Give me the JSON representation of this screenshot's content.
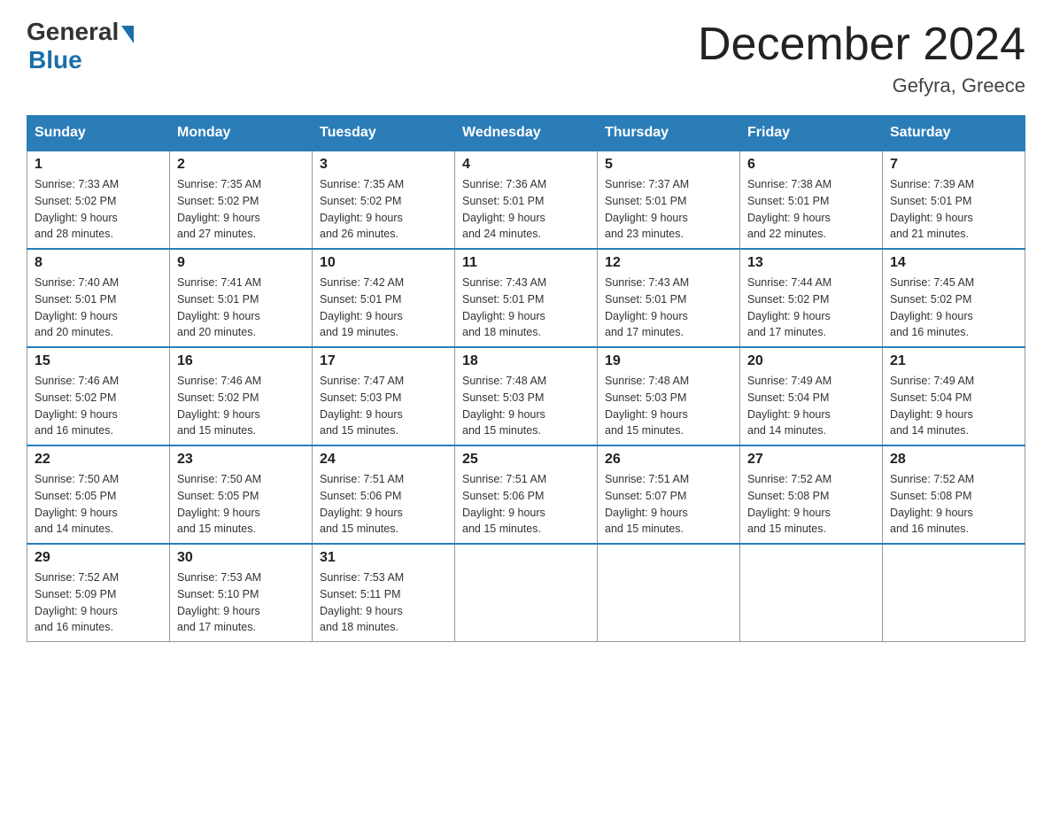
{
  "header": {
    "logo_general": "General",
    "logo_blue": "Blue",
    "month_title": "December 2024",
    "location": "Gefyra, Greece"
  },
  "days_of_week": [
    "Sunday",
    "Monday",
    "Tuesday",
    "Wednesday",
    "Thursday",
    "Friday",
    "Saturday"
  ],
  "weeks": [
    [
      {
        "day": "1",
        "sunrise": "7:33 AM",
        "sunset": "5:02 PM",
        "daylight": "9 hours and 28 minutes."
      },
      {
        "day": "2",
        "sunrise": "7:35 AM",
        "sunset": "5:02 PM",
        "daylight": "9 hours and 27 minutes."
      },
      {
        "day": "3",
        "sunrise": "7:35 AM",
        "sunset": "5:02 PM",
        "daylight": "9 hours and 26 minutes."
      },
      {
        "day": "4",
        "sunrise": "7:36 AM",
        "sunset": "5:01 PM",
        "daylight": "9 hours and 24 minutes."
      },
      {
        "day": "5",
        "sunrise": "7:37 AM",
        "sunset": "5:01 PM",
        "daylight": "9 hours and 23 minutes."
      },
      {
        "day": "6",
        "sunrise": "7:38 AM",
        "sunset": "5:01 PM",
        "daylight": "9 hours and 22 minutes."
      },
      {
        "day": "7",
        "sunrise": "7:39 AM",
        "sunset": "5:01 PM",
        "daylight": "9 hours and 21 minutes."
      }
    ],
    [
      {
        "day": "8",
        "sunrise": "7:40 AM",
        "sunset": "5:01 PM",
        "daylight": "9 hours and 20 minutes."
      },
      {
        "day": "9",
        "sunrise": "7:41 AM",
        "sunset": "5:01 PM",
        "daylight": "9 hours and 20 minutes."
      },
      {
        "day": "10",
        "sunrise": "7:42 AM",
        "sunset": "5:01 PM",
        "daylight": "9 hours and 19 minutes."
      },
      {
        "day": "11",
        "sunrise": "7:43 AM",
        "sunset": "5:01 PM",
        "daylight": "9 hours and 18 minutes."
      },
      {
        "day": "12",
        "sunrise": "7:43 AM",
        "sunset": "5:01 PM",
        "daylight": "9 hours and 17 minutes."
      },
      {
        "day": "13",
        "sunrise": "7:44 AM",
        "sunset": "5:02 PM",
        "daylight": "9 hours and 17 minutes."
      },
      {
        "day": "14",
        "sunrise": "7:45 AM",
        "sunset": "5:02 PM",
        "daylight": "9 hours and 16 minutes."
      }
    ],
    [
      {
        "day": "15",
        "sunrise": "7:46 AM",
        "sunset": "5:02 PM",
        "daylight": "9 hours and 16 minutes."
      },
      {
        "day": "16",
        "sunrise": "7:46 AM",
        "sunset": "5:02 PM",
        "daylight": "9 hours and 15 minutes."
      },
      {
        "day": "17",
        "sunrise": "7:47 AM",
        "sunset": "5:03 PM",
        "daylight": "9 hours and 15 minutes."
      },
      {
        "day": "18",
        "sunrise": "7:48 AM",
        "sunset": "5:03 PM",
        "daylight": "9 hours and 15 minutes."
      },
      {
        "day": "19",
        "sunrise": "7:48 AM",
        "sunset": "5:03 PM",
        "daylight": "9 hours and 15 minutes."
      },
      {
        "day": "20",
        "sunrise": "7:49 AM",
        "sunset": "5:04 PM",
        "daylight": "9 hours and 14 minutes."
      },
      {
        "day": "21",
        "sunrise": "7:49 AM",
        "sunset": "5:04 PM",
        "daylight": "9 hours and 14 minutes."
      }
    ],
    [
      {
        "day": "22",
        "sunrise": "7:50 AM",
        "sunset": "5:05 PM",
        "daylight": "9 hours and 14 minutes."
      },
      {
        "day": "23",
        "sunrise": "7:50 AM",
        "sunset": "5:05 PM",
        "daylight": "9 hours and 15 minutes."
      },
      {
        "day": "24",
        "sunrise": "7:51 AM",
        "sunset": "5:06 PM",
        "daylight": "9 hours and 15 minutes."
      },
      {
        "day": "25",
        "sunrise": "7:51 AM",
        "sunset": "5:06 PM",
        "daylight": "9 hours and 15 minutes."
      },
      {
        "day": "26",
        "sunrise": "7:51 AM",
        "sunset": "5:07 PM",
        "daylight": "9 hours and 15 minutes."
      },
      {
        "day": "27",
        "sunrise": "7:52 AM",
        "sunset": "5:08 PM",
        "daylight": "9 hours and 15 minutes."
      },
      {
        "day": "28",
        "sunrise": "7:52 AM",
        "sunset": "5:08 PM",
        "daylight": "9 hours and 16 minutes."
      }
    ],
    [
      {
        "day": "29",
        "sunrise": "7:52 AM",
        "sunset": "5:09 PM",
        "daylight": "9 hours and 16 minutes."
      },
      {
        "day": "30",
        "sunrise": "7:53 AM",
        "sunset": "5:10 PM",
        "daylight": "9 hours and 17 minutes."
      },
      {
        "day": "31",
        "sunrise": "7:53 AM",
        "sunset": "5:11 PM",
        "daylight": "9 hours and 18 minutes."
      },
      null,
      null,
      null,
      null
    ]
  ],
  "labels": {
    "sunrise": "Sunrise:",
    "sunset": "Sunset:",
    "daylight": "Daylight:"
  }
}
